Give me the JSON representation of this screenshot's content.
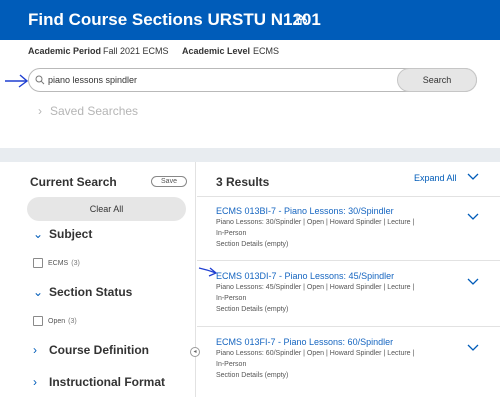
{
  "header": {
    "title": "Find Course Sections URSTU N1201",
    "academic_period_label": "Academic Period",
    "academic_period_value": "Fall 2021 ECMS",
    "academic_level_label": "Academic Level",
    "academic_level_value": "ECMS"
  },
  "search": {
    "value": "piano lessons spindler",
    "button_label": "Search",
    "saved_searches_label": "Saved Searches"
  },
  "left": {
    "current_search_label": "Current Search",
    "save_label": "Save",
    "clear_all_label": "Clear All",
    "facets": {
      "subject": {
        "label": "Subject",
        "option": "ECMS",
        "count": "(3)"
      },
      "section_status": {
        "label": "Section Status",
        "option": "Open",
        "count": "(3)"
      },
      "course_definition": {
        "label": "Course Definition"
      },
      "instructional_format": {
        "label": "Instructional Format"
      }
    }
  },
  "results": {
    "count_label": "3 Results",
    "expand_all_label": "Expand All",
    "items": [
      {
        "title": "ECMS 013BI-7 - Piano Lessons: 30/Spindler",
        "info": "Piano Lessons: 30/Spindler  |  Open  |  Howard Spindler  |  Lecture  |",
        "delivery": "In-Person",
        "details": "Section Details (empty)"
      },
      {
        "title": "ECMS 013DI-7 - Piano Lessons: 45/Spindler",
        "info": "Piano Lessons: 45/Spindler  |  Open  |  Howard Spindler  |  Lecture  |",
        "delivery": "In-Person",
        "details": "Section Details (empty)"
      },
      {
        "title": "ECMS 013FI-7 - Piano Lessons: 60/Spindler",
        "info": "Piano Lessons: 60/Spindler  |  Open  |  Howard Spindler  |  Lecture  |",
        "delivery": "In-Person",
        "details": "Section Details (empty)"
      }
    ]
  },
  "colors": {
    "brand_blue": "#005cb9",
    "link_blue": "#1565c0",
    "annotation_blue": "#1f3fd1"
  },
  "icons": {
    "title_icon": "related-actions-icon",
    "search": "search-icon",
    "chevron": "chevron-down-icon",
    "annotation": "hand-drawn-arrow-icon"
  }
}
